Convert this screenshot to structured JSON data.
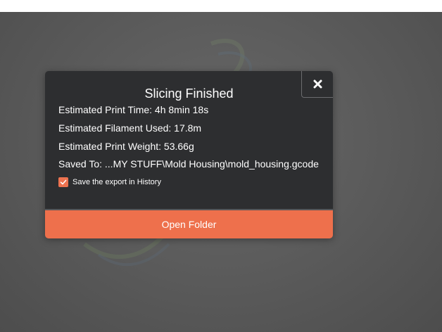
{
  "dialog": {
    "title": "Slicing Finished",
    "print_time": "Estimated Print Time: 4h 8min 18s",
    "filament_used": "Estimated Filament Used: 17.8m",
    "print_weight": "Estimated Print Weight: 53.66g",
    "saved_to": "Saved To: ...MY STUFF\\Mold Housing\\mold_housing.gcode",
    "history_checkbox": {
      "label": "Save the export in History",
      "checked": true
    },
    "open_folder_label": "Open Folder",
    "close_icon": "close-icon"
  },
  "colors": {
    "accent": "#ee704c",
    "dialog_bg": "#2d2e30",
    "viewport_bg": "#5c5c5c"
  }
}
